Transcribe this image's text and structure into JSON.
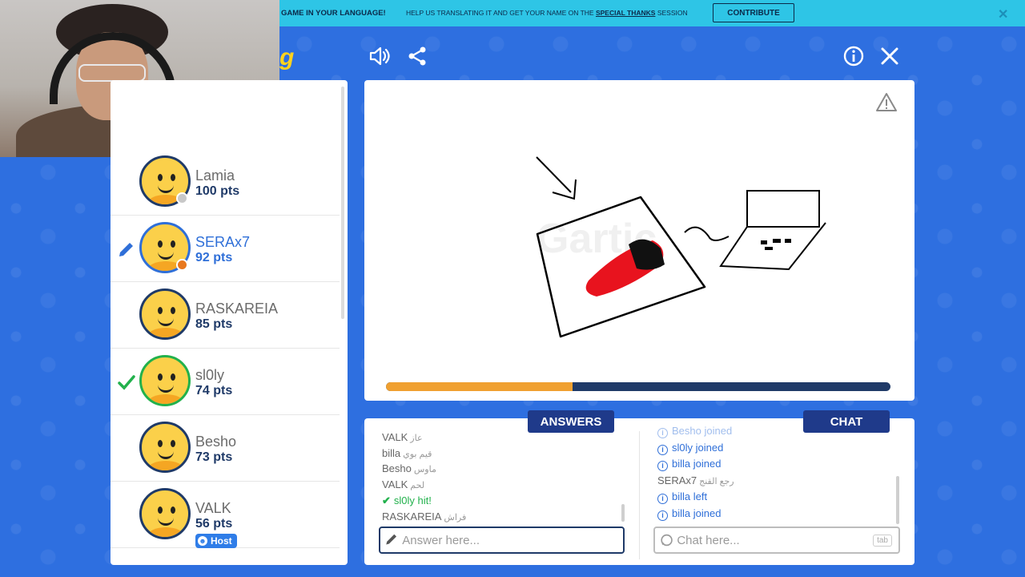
{
  "banner": {
    "main": "GAME IN YOUR LANGUAGE!",
    "help_prefix": "HELP US TRANSLATING IT AND GET YOUR NAME ON THE",
    "help_link": "SPECIAL THANKS",
    "help_suffix": "SESSION",
    "contribute_label": "CONTRIBUTE",
    "close_glyph": "✕"
  },
  "header": {
    "logo_fragment": "g",
    "icons": [
      "sound-icon",
      "share-icon",
      "info-icon",
      "close-icon"
    ]
  },
  "players": [
    {
      "name": "Lamia",
      "points": "100 pts",
      "status_color": "#c8c8c8",
      "mark": "",
      "host": false
    },
    {
      "name": "SERAx7",
      "points": "92 pts",
      "status_color": "#e8781e",
      "mark": "pencil",
      "host": false,
      "highlight": "#2f6fd8"
    },
    {
      "name": "RASKAREIA",
      "points": "85 pts",
      "status_color": "",
      "mark": "",
      "host": false
    },
    {
      "name": "sl0ly",
      "points": "74 pts",
      "status_color": "",
      "mark": "check",
      "host": false
    },
    {
      "name": "Besho",
      "points": "73 pts",
      "status_color": "",
      "mark": "",
      "host": false
    },
    {
      "name": "VALK",
      "points": "56 pts",
      "status_color": "",
      "mark": "",
      "host": true,
      "host_label": "Host"
    }
  ],
  "canvas": {
    "progress_fraction": 0.37,
    "progress_color": "#f0a030",
    "track_color": "#1f3a68"
  },
  "answers": {
    "tab_label": "ANSWERS",
    "messages": [
      {
        "who": "VALK",
        "text": "عاز"
      },
      {
        "who": "billa",
        "text": "قيم بوي"
      },
      {
        "who": "Besho",
        "text": "ماوس"
      },
      {
        "who": "VALK",
        "text": "لحم"
      },
      {
        "who": "sl0ly",
        "text": "hit!",
        "type": "hit"
      },
      {
        "who": "RASKAREIA",
        "text": "فراش"
      }
    ],
    "placeholder": "Answer here..."
  },
  "chat": {
    "tab_label": "CHAT",
    "messages": [
      {
        "who": "Besho",
        "text": "joined",
        "type": "sys"
      },
      {
        "who": "sl0ly",
        "text": "joined",
        "type": "sys"
      },
      {
        "who": "billa",
        "text": "joined",
        "type": "sys"
      },
      {
        "who": "SERAx7",
        "text": "رجع القنج",
        "type": "plain"
      },
      {
        "who": "billa",
        "text": "left",
        "type": "sys"
      },
      {
        "who": "billa",
        "text": "joined",
        "type": "sys"
      }
    ],
    "placeholder": "Chat here...",
    "tab_hint": "tab"
  },
  "colors": {
    "background": "#2e6fe0",
    "banner": "#2ec5e6",
    "navy": "#1f3a68",
    "tab": "#1f3a8a"
  }
}
